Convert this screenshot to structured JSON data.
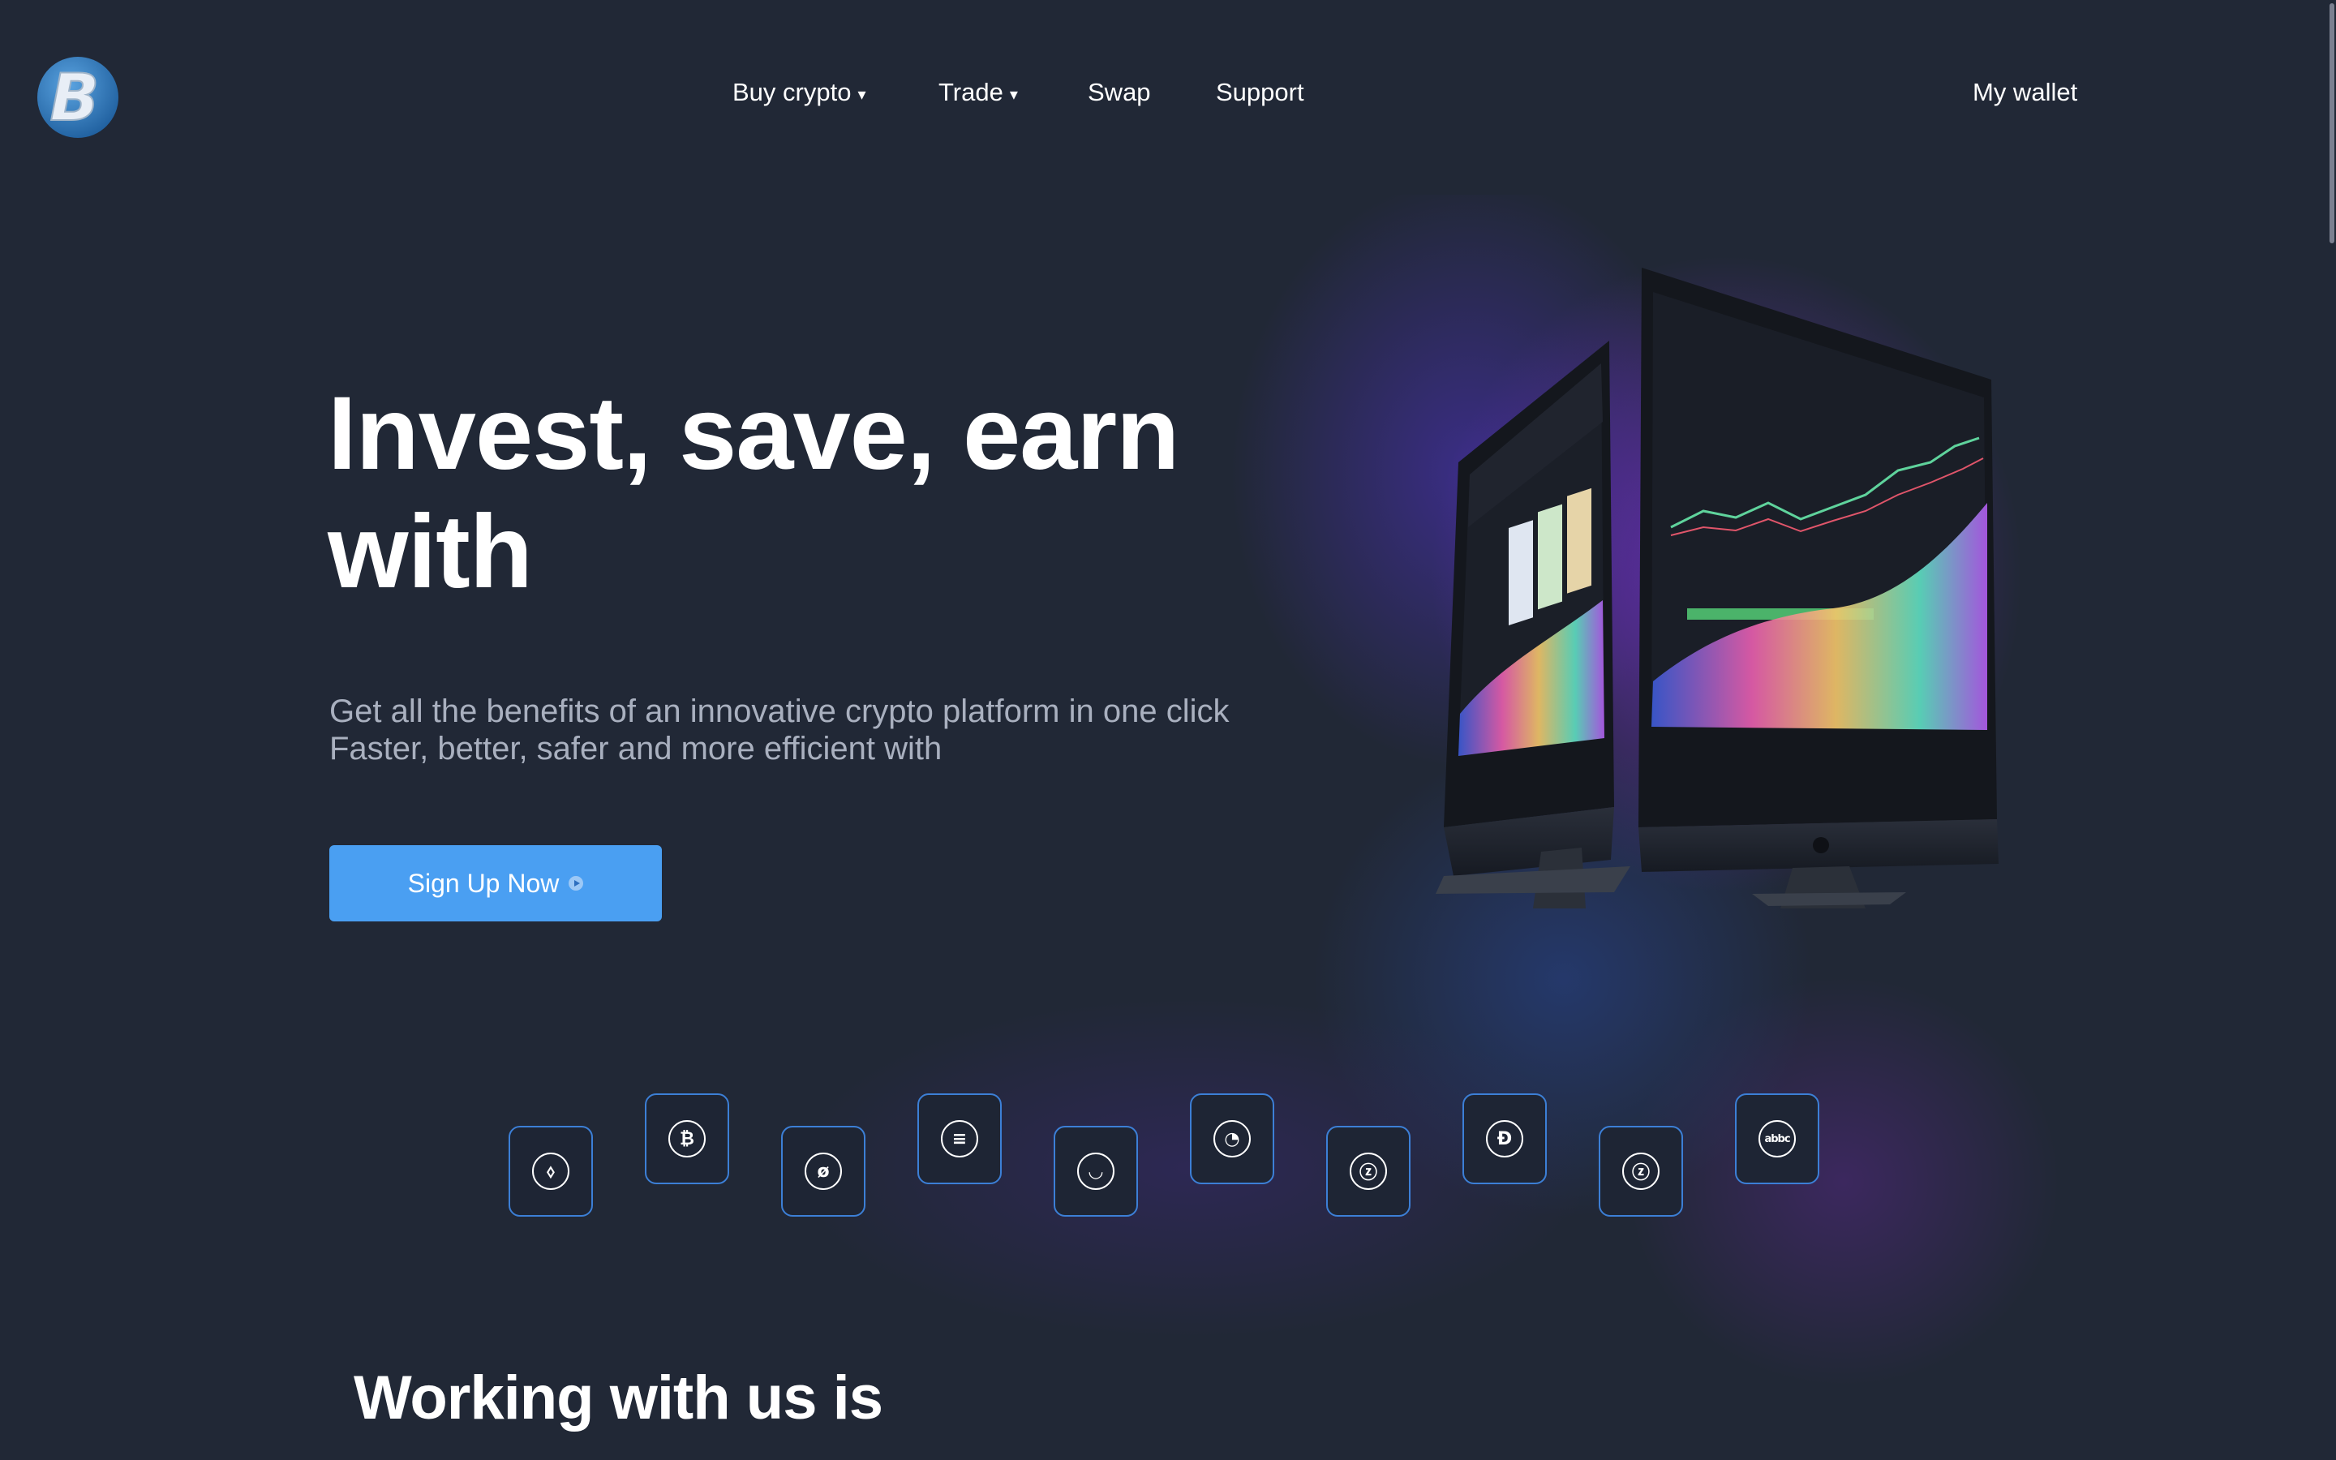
{
  "header": {
    "nav": [
      {
        "label": "Buy crypto",
        "caret": "▾"
      },
      {
        "label": "Trade",
        "caret": "▾"
      },
      {
        "label": "Swap",
        "caret": ""
      },
      {
        "label": "Support",
        "caret": ""
      }
    ],
    "wallet_label": "My wallet",
    "logo_icon": "b-logo-icon"
  },
  "hero": {
    "title_line1": "Invest, save, earn",
    "title_line2": "with",
    "subtitle_line1": "Get all the benefits of an innovative crypto platform in one click",
    "subtitle_line2": "Faster, better, safer and more efficient with",
    "cta_label": "Sign Up Now"
  },
  "coins": [
    {
      "icon": "ethereum-icon",
      "glyph": "⬨"
    },
    {
      "icon": "bitcoin-icon",
      "glyph": "₿"
    },
    {
      "icon": "solana-slash-icon",
      "glyph": "ø"
    },
    {
      "icon": "stripes-coin-icon",
      "glyph": "≡"
    },
    {
      "icon": "bowl-coin-icon",
      "glyph": "◡"
    },
    {
      "icon": "pie-coin-icon",
      "glyph": "◔"
    },
    {
      "icon": "zcash-icon",
      "glyph": "ⓩ"
    },
    {
      "icon": "dogecoin-icon",
      "glyph": "Đ"
    },
    {
      "icon": "zcash-icon",
      "glyph": "ⓩ"
    },
    {
      "icon": "abbc-icon",
      "glyph": "abbc"
    }
  ],
  "section": {
    "title": "Working with us is"
  },
  "colors": {
    "background": "#212836",
    "accent": "#4a9ff2",
    "coin_border": "#3c7fd6",
    "subtitle": "#a9b0bf"
  }
}
